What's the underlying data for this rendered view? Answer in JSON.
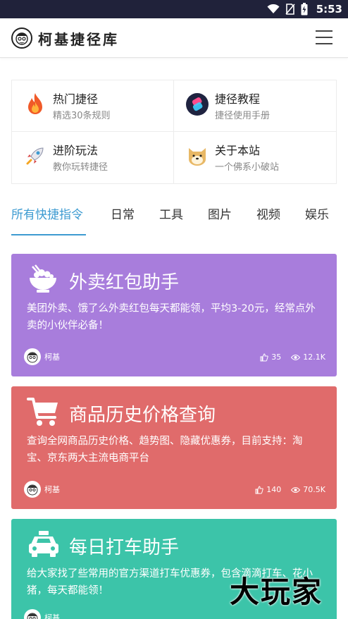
{
  "status_bar": {
    "time": "5:53"
  },
  "header": {
    "title": "柯基捷径库"
  },
  "features": [
    {
      "title": "热门捷径",
      "subtitle": "精选30条规则",
      "icon": "fire-icon"
    },
    {
      "title": "捷径教程",
      "subtitle": "捷径使用手册",
      "icon": "shortcuts-app-icon"
    },
    {
      "title": "进阶玩法",
      "subtitle": "教你玩转捷径",
      "icon": "rocket-icon"
    },
    {
      "title": "关于本站",
      "subtitle": "一个佛系小破站",
      "icon": "doge-icon"
    }
  ],
  "tabs": [
    {
      "label": "所有快捷指令",
      "active": true
    },
    {
      "label": "日常"
    },
    {
      "label": "工具"
    },
    {
      "label": "图片"
    },
    {
      "label": "视频"
    },
    {
      "label": "娱乐"
    }
  ],
  "cards": [
    {
      "title": "外卖红包助手",
      "desc": "美团外卖、饿了么外卖红包每天都能领，平均3-20元，经常点外卖的小伙伴必备！",
      "author": "柯基",
      "likes": "35",
      "views": "12.1K",
      "color": "#a87ddc",
      "icon": "rice-bowl-icon"
    },
    {
      "title": "商品历史价格查询",
      "desc": "查询全网商品历史价格、趋势图、隐藏优惠券，目前支持：淘宝、京东两大主流电商平台",
      "author": "柯基",
      "likes": "140",
      "views": "70.5K",
      "color": "#e06b6b",
      "icon": "cart-icon"
    },
    {
      "title": "每日打车助手",
      "desc": "给大家找了些常用的官方渠道打车优惠券，包含滴滴打车、花小猪，每天都能领！",
      "author": "柯基",
      "color": "#3cc4a9",
      "icon": "taxi-icon"
    }
  ],
  "watermark": "大玩家"
}
